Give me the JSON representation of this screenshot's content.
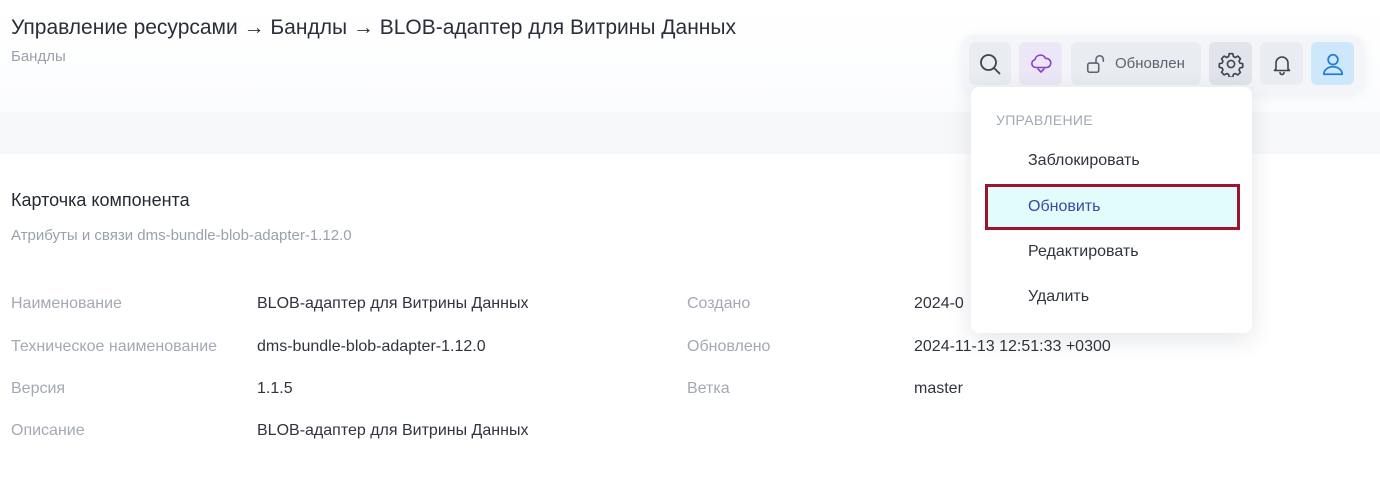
{
  "header": {
    "breadcrumb": "Управление ресурсами → Бандлы → BLOB-адаптер для Витрины Данных",
    "subtitle": "Бандлы"
  },
  "toolbar": {
    "search_icon": "search-icon",
    "cloud_icon": "cloud-download-icon",
    "status_label": "Обновлен",
    "lock_icon": "unlock-icon",
    "settings_icon": "gear-icon",
    "bell_icon": "bell-icon",
    "user_icon": "user-icon"
  },
  "card": {
    "title": "Карточка компонента",
    "subtitle": "Атрибуты и связи dms-bundle-blob-adapter-1.12.0"
  },
  "attributes": {
    "left": [
      {
        "label": "Наименование",
        "value": "BLOB-адаптер для Витрины Данных"
      },
      {
        "label": "Техническое наименование",
        "value": "dms-bundle-blob-adapter-1.12.0"
      },
      {
        "label": "Версия",
        "value": "1.1.5"
      },
      {
        "label": "Описание",
        "value": "BLOB-адаптер для Витрины Данных"
      }
    ],
    "right": [
      {
        "label": "Создано",
        "value": "2024-0"
      },
      {
        "label": "Обновлено",
        "value": "2024-11-13 12:51:33 +0300"
      },
      {
        "label": "Ветка",
        "value": "master"
      }
    ]
  },
  "menu": {
    "header": "УПРАВЛЕНИЕ",
    "items": [
      {
        "label": "Заблокировать"
      },
      {
        "label": "Обновить",
        "highlighted": true
      },
      {
        "label": "Редактировать"
      },
      {
        "label": "Удалить"
      }
    ]
  },
  "colors": {
    "highlight_border": "#9b1430",
    "highlight_bg": "#e2fcfc",
    "highlight_text": "#3a48a6",
    "user_button_bg": "#cfe7fb",
    "cloud_icon": "#8a3fd0"
  }
}
